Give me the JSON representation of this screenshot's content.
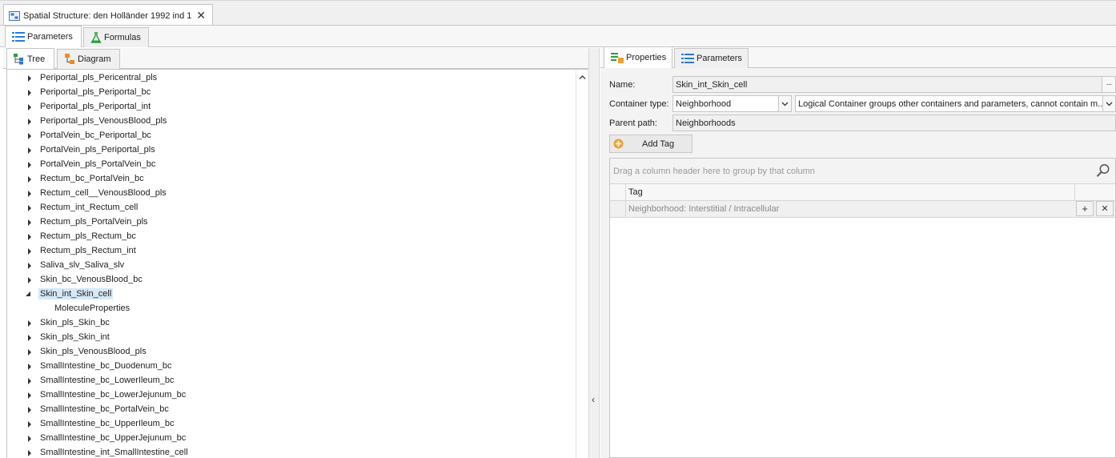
{
  "document_tab": {
    "title": "Spatial Structure: den Holländer 1992 ind 1",
    "close_glyph": "✕"
  },
  "main_tabs": [
    {
      "label": "Parameters",
      "icon": "list-icon"
    },
    {
      "label": "Formulas",
      "icon": "flask-icon"
    }
  ],
  "left_tabs": [
    {
      "label": "Tree",
      "icon": "tree-icon"
    },
    {
      "label": "Diagram",
      "icon": "diagram-icon"
    }
  ],
  "tree": {
    "items": [
      {
        "label": "Periportal_pls_Pericentral_pls"
      },
      {
        "label": "Periportal_pls_Periportal_bc"
      },
      {
        "label": "Periportal_pls_Periportal_int"
      },
      {
        "label": "Periportal_pls_VenousBlood_pls"
      },
      {
        "label": "PortalVein_bc_Periportal_bc"
      },
      {
        "label": "PortalVein_pls_Periportal_pls"
      },
      {
        "label": "PortalVein_pls_PortalVein_bc"
      },
      {
        "label": "Rectum_bc_PortalVein_bc"
      },
      {
        "label": "Rectum_cell__VenousBlood_pls"
      },
      {
        "label": "Rectum_int_Rectum_cell"
      },
      {
        "label": "Rectum_pls_PortalVein_pls"
      },
      {
        "label": "Rectum_pls_Rectum_bc"
      },
      {
        "label": "Rectum_pls_Rectum_int"
      },
      {
        "label": "Saliva_slv_Saliva_slv"
      },
      {
        "label": "Skin_bc_VenousBlood_bc"
      },
      {
        "label": "Skin_int_Skin_cell"
      },
      {
        "label": "MoleculeProperties"
      },
      {
        "label": "Skin_pls_Skin_bc"
      },
      {
        "label": "Skin_pls_Skin_int"
      },
      {
        "label": "Skin_pls_VenousBlood_pls"
      },
      {
        "label": "SmallIntestine_bc_Duodenum_bc"
      },
      {
        "label": "SmallIntestine_bc_LowerIleum_bc"
      },
      {
        "label": "SmallIntestine_bc_LowerJejunum_bc"
      },
      {
        "label": "SmallIntestine_bc_PortalVein_bc"
      },
      {
        "label": "SmallIntestine_bc_UpperIleum_bc"
      },
      {
        "label": "SmallIntestine_bc_UpperJejunum_bc"
      },
      {
        "label": "SmallIntestine_int_SmallIntestine_cell"
      }
    ]
  },
  "right_tabs": [
    {
      "label": "Properties",
      "icon": "properties-icon"
    },
    {
      "label": "Parameters",
      "icon": "list-icon"
    }
  ],
  "properties": {
    "name_label": "Name:",
    "name_value": "Skin_int_Skin_cell",
    "ellipsis": "···",
    "container_type_label": "Container type:",
    "container_type_value": "Neighborhood",
    "container_description": "Logical Container groups other containers and parameters, cannot contain m...",
    "parent_path_label": "Parent path:",
    "parent_path_value": "Neighborhoods",
    "add_tag_label": "Add Tag"
  },
  "tag_grid": {
    "group_hint": "Drag a column header here to group by that column",
    "column_header": "Tag",
    "rows": [
      "Neighborhood: Interstitial / Intracellular"
    ],
    "add_glyph": "+",
    "remove_glyph": "✕"
  },
  "splitter": {
    "collapse_glyph": "‹"
  },
  "colors": {
    "selection": "#d6e8f7",
    "add_icon": "#f0a030",
    "border": "#c6c6c6"
  }
}
